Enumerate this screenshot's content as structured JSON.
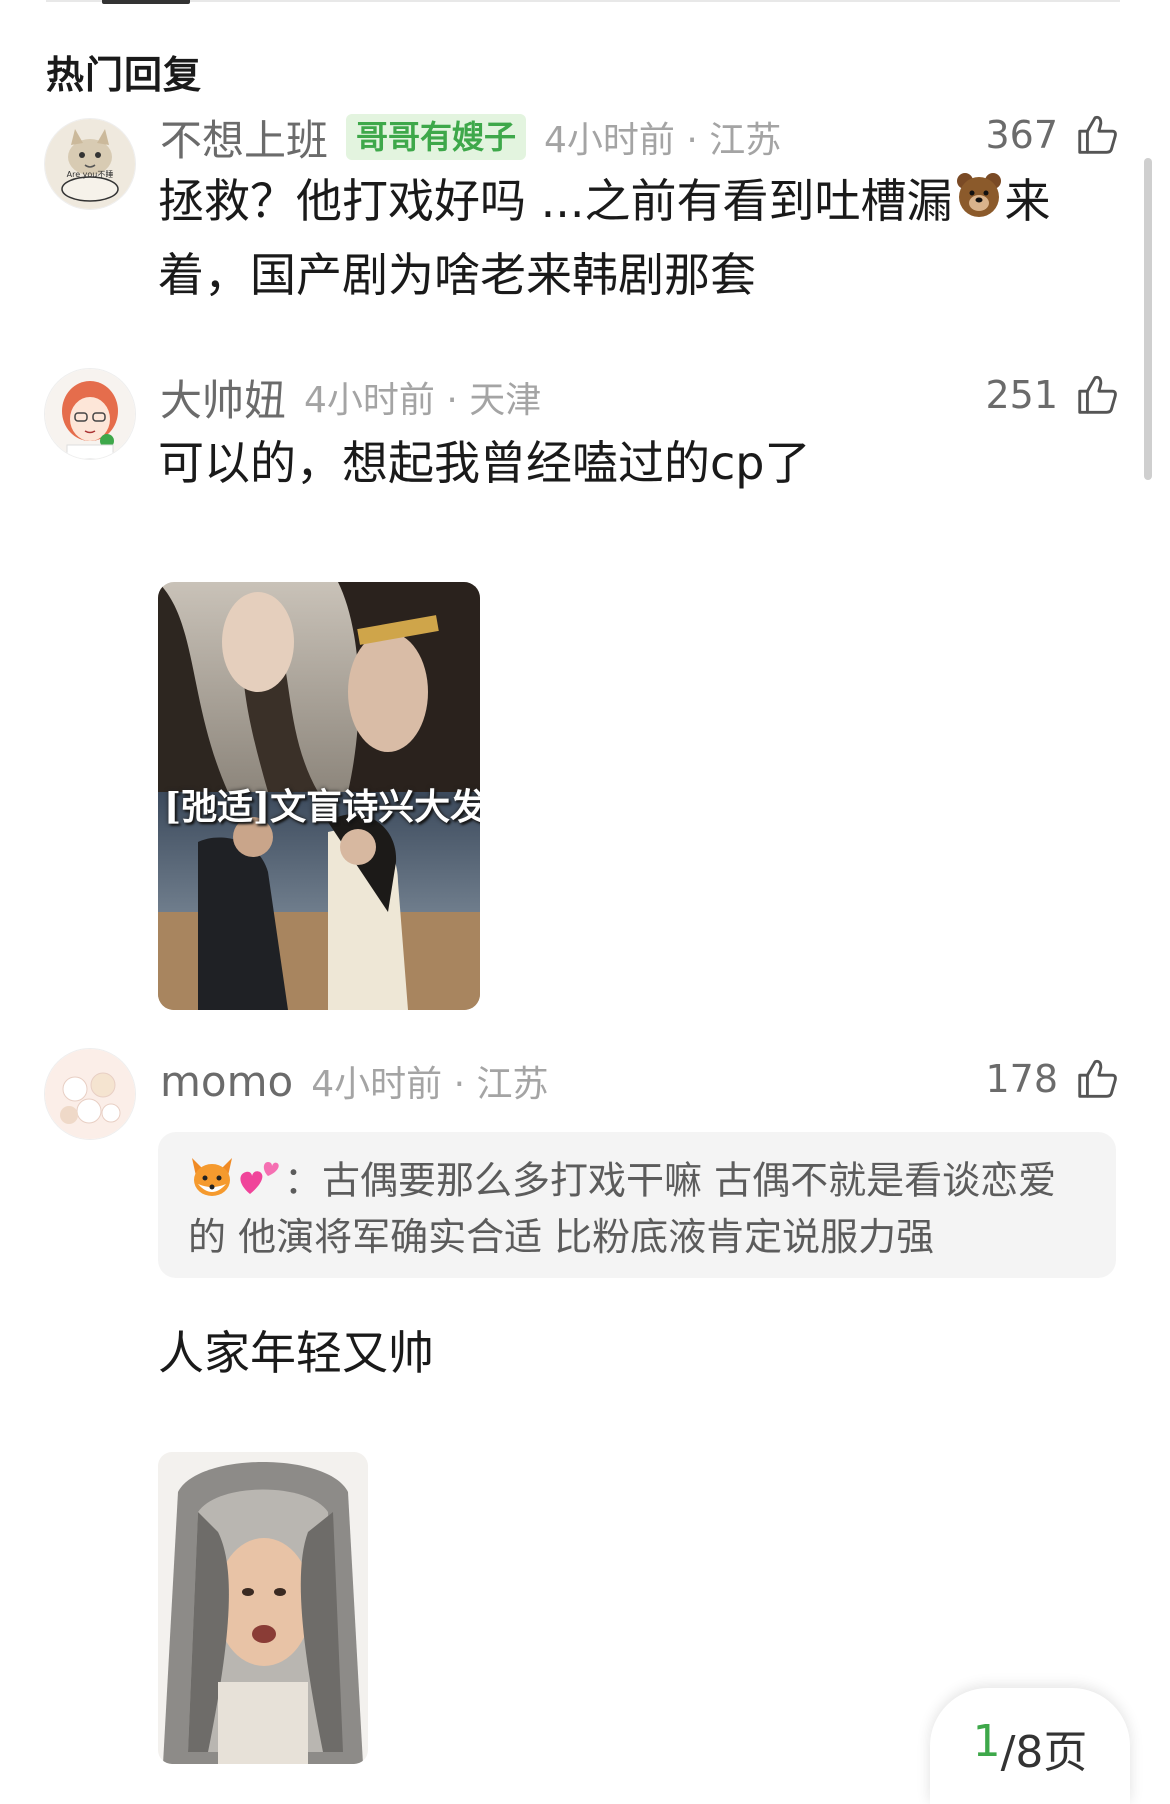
{
  "section_title": "热门回复",
  "comments": [
    {
      "username": "不想上班",
      "badge": "哥哥有嫂子",
      "time_location": "4小时前 · 江苏",
      "likes": "367",
      "text_part1": "拯救？他打戏好吗 ...之前有看到吐槽漏",
      "text_emoji": "bear-emoji",
      "text_part2": "来着，国产剧为啥老来韩剧那套",
      "avatar_text": "Are you不睡"
    },
    {
      "username": "大帅妞",
      "time_location": "4小时前 · 天津",
      "likes": "251",
      "text": "可以的，想起我曾经嗑过的cp了",
      "attachment_caption": "[弛适]文盲诗兴大发"
    },
    {
      "username": "momo",
      "time_location": "4小时前 · 江苏",
      "likes": "178",
      "quote_text": "：古偶要那么多打戏干嘛 古偶不就是看谈恋爱的 他演将军确实合适 比粉底液肯定说服力强",
      "quote_emojis": [
        "fox-emoji",
        "hearts-emoji"
      ],
      "text": "人家年轻又帅"
    }
  ],
  "page_indicator": {
    "current": "1",
    "rest": "/8页"
  },
  "colors": {
    "badge_bg": "#e3f4df",
    "badge_fg": "#3ea84a",
    "meta": "#a4a4a4"
  }
}
